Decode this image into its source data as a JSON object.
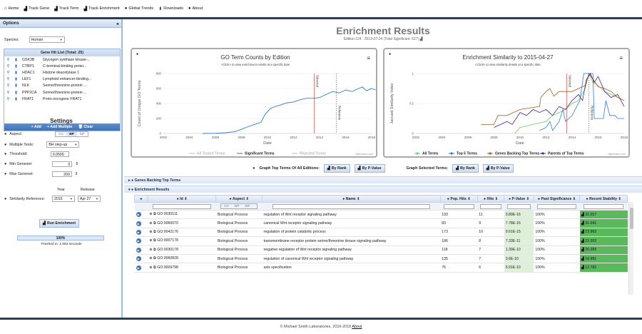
{
  "nav": [
    {
      "icon": "home-icon",
      "glyph": "⌂",
      "label": "Home"
    },
    {
      "icon": "chart-icon",
      "glyph": "▟",
      "label": "Track Gene"
    },
    {
      "icon": "chart-icon",
      "glyph": "▟",
      "label": "Track Term"
    },
    {
      "icon": "chart-icon",
      "glyph": "▟",
      "label": "Track Enrichment"
    },
    {
      "icon": "globe-icon",
      "glyph": "●",
      "label": "Global Trends"
    },
    {
      "icon": "download-icon",
      "glyph": "⬇",
      "label": "Downloads"
    },
    {
      "icon": "info-icon",
      "glyph": "●",
      "label": "About"
    }
  ],
  "options": {
    "title": "Options",
    "collapse": "◂",
    "species_label": "Species:",
    "species": "Human"
  },
  "genes": {
    "header": "Gene Hit List (Total: 25)",
    "items": [
      {
        "sym": "GSK3B",
        "desc": "Glycogen synthase kinase-..."
      },
      {
        "sym": "CTBP1",
        "desc": "C-terminal-binding protei..."
      },
      {
        "sym": "HDAC1",
        "desc": "Histone deacetylase 1"
      },
      {
        "sym": "LEF1",
        "desc": "Lymphoid enhancer-binding..."
      },
      {
        "sym": "NLK",
        "desc": "Serine/threonine-protein ..."
      },
      {
        "sym": "PPP2CA",
        "desc": "Serine/threonine-protein ..."
      },
      {
        "sym": "FRAT1",
        "desc": "Proto-oncogene FRAT1"
      }
    ],
    "add": "+ Add",
    "add_multiple": "+ Add Multiple",
    "clear": "🗑 Clear"
  },
  "settings": {
    "title": "Settings",
    "aspect_label": "Aspect:",
    "aspects": [
      "CC",
      "BP",
      "MF"
    ],
    "multiple_tests_label": "Multiple Tests:",
    "multiple_tests": "BH step-up",
    "threshold_label": "Threshold:",
    "threshold": "0.0500",
    "min_label": "Min Geneset:",
    "min": "5",
    "max_label": "Max Geneset:",
    "max": "200",
    "sim_label": "Similarity Reference:",
    "year_label": "Year",
    "release_label": "Release",
    "year": "2015",
    "release": "Apr 27",
    "run": "Run Enrichment",
    "progress": "100%",
    "finished": "Finished in: 1.653 seconds"
  },
  "results": {
    "title": "Enrichment Results",
    "subtitle": "Edition 124 : 2013-07-24 (Total Significant: 627)"
  },
  "chart1": {
    "title": "GO Term Counts by Edition",
    "subtitle": "<Click> to view enrichment results at a specific date",
    "ylabel": "Count of Unique GO Terms",
    "xlabel": "Date",
    "selected": "Selected",
    "reference": "Reference",
    "legend": [
      "All Tested Terms",
      "Significant Terms",
      "Rejected Terms"
    ],
    "credit": "Highcharts.com",
    "xticks": [
      "2002",
      "2004",
      "2006",
      "2008",
      "2010",
      "2012",
      "2014",
      "2016",
      "2018"
    ],
    "yticks": [
      "0",
      "200",
      "400",
      "600",
      "800"
    ]
  },
  "chart2": {
    "title": "Enrichment Similarity to 2015-04-27",
    "subtitle": "<Click> to view similarity details at a specific date",
    "ylabel": "Jaccard Similarity Index",
    "xlabel": "Date",
    "selected": "Selected",
    "reference": "Reference",
    "legend": [
      "All Terms",
      "Top 5 Terms",
      "Genes Backing Top Terms",
      "Parents of Top Terms"
    ],
    "credit": "Highcharts.com",
    "xticks": [
      "2002",
      "2004",
      "2006",
      "2008",
      "2010",
      "2012",
      "2014",
      "2016",
      "2018"
    ],
    "yticks": [
      "0",
      "0.5",
      "1"
    ]
  },
  "colors": {
    "green": "#5cd65c",
    "blue": "#2b7bd6",
    "orange": "#b05a1c",
    "purple": "#5a1a8c",
    "accent": "#3f73b3"
  },
  "graph_row": {
    "top_label": "Graph Top Terms Of All Editions:",
    "by_rank": "By Rank",
    "by_pvalue": "By P-Value",
    "selected_label": "Graph Selected Terms:"
  },
  "sections": {
    "genes_backing": "Genes Backing Top Terms",
    "enrichment": "Enrichment Results"
  },
  "table": {
    "headers": [
      "Id",
      "Aspect",
      "Name",
      "Pop. Hits",
      "Hits",
      "P-Value",
      "Past Significance",
      "Recent Stability"
    ],
    "rows": [
      [
        "GO:0030111",
        "Biological Process",
        "regulation of Wnt receptor signaling pathway",
        "193",
        "11",
        "3.89E-16",
        "100%",
        "32.257"
      ],
      [
        "GO:0060070",
        "Biological Process",
        "canonical Wnt receptor signaling pathway",
        "83",
        "9",
        "7.78E-16",
        "100%",
        "31.041"
      ],
      [
        "GO:0042176",
        "Biological Process",
        "regulation of protein catabolic process",
        "173",
        "10",
        "9.61E-15",
        "100%",
        "23.963"
      ],
      [
        "GO:0007178",
        "Biological Process",
        "transmembrane receptor protein serine/threonine kinase signaling pathway",
        "186",
        "8",
        "7.33E-11",
        "100%",
        "22.202"
      ],
      [
        "GO:0030178",
        "Biological Process",
        "negative regulation of Wnt receptor signaling pathway",
        "118",
        "7",
        "1.39E-10",
        "100%",
        "20.283"
      ],
      [
        "GO:0060828",
        "Biological Process",
        "regulation of canonical Wnt receptor signaling pathway",
        "135",
        "7",
        "3.6E-10",
        "100%",
        "18.981"
      ],
      [
        "GO:0009798",
        "Biological Process",
        "axis specification",
        "76",
        "6",
        "5.91E-10",
        "100%",
        "12.782"
      ]
    ]
  },
  "footer": {
    "text": "© Michael Smith Laboratories, 2016-2018",
    "about": "About"
  }
}
